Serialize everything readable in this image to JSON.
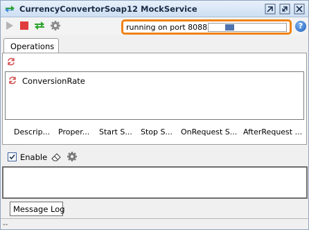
{
  "window": {
    "title": "CurrencyConvertorSoap12 MockService",
    "title_icon": "mock-service-icon",
    "controls": [
      "minimize-restore-icon",
      "maximize-icon",
      "close-icon"
    ]
  },
  "toolbar": {
    "buttons": [
      "play-icon",
      "stop-icon",
      "swap-icon",
      "gear-icon"
    ],
    "status": "running on port 8088",
    "port_progress": 0.3,
    "help_label": "?"
  },
  "operations": {
    "tab_label": "Operations",
    "items": [
      {
        "label": "ConversionRate",
        "icon": "refresh-icon"
      }
    ],
    "columns": [
      "Descrip...",
      "Proper...",
      "Start S...",
      "Stop S...",
      "OnRequest S...",
      "AfterRequest ..."
    ]
  },
  "log": {
    "enable_label": "Enable",
    "enable_checked": true,
    "tab_label": "Message Log",
    "status_text": "--"
  },
  "colors": {
    "highlight": "#f08214",
    "stop": "#e03c3c",
    "swap": "#2fa52f",
    "accent": "#4f74ad"
  }
}
